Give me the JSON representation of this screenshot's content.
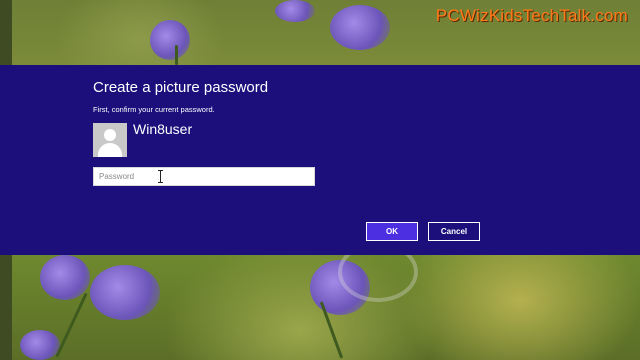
{
  "watermark": "PCWizKidsTechTalk.com",
  "dialog": {
    "title": "Create a picture password",
    "subtitle": "First, confirm your current password.",
    "username": "Win8user",
    "password": {
      "value": "",
      "placeholder": "Password"
    },
    "buttons": {
      "ok_label": "OK",
      "cancel_label": "Cancel"
    }
  },
  "colors": {
    "dialog_background": "#1c0f7c",
    "ok_button": "#4b2fe0",
    "watermark": "#ff7a1a"
  },
  "icons": {
    "avatar": "user-silhouette-icon",
    "cursor": "text-cursor-icon"
  }
}
